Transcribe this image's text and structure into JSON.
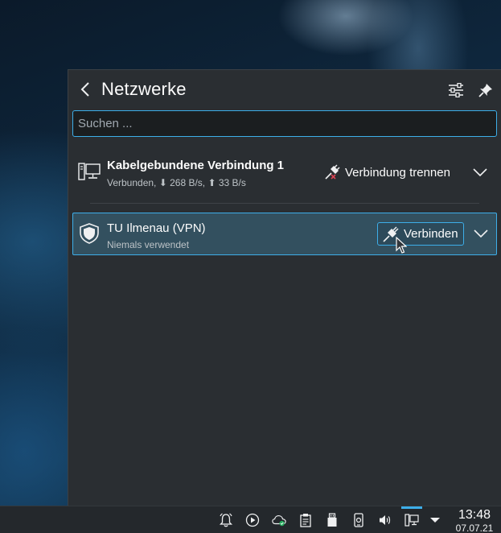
{
  "applet": {
    "title": "Netzwerke",
    "search_placeholder": "Suchen ...",
    "connections": [
      {
        "name": "Kabelgebundene Verbindung 1",
        "status": "Verbunden, ⬇ 268 B/s, ⬆ 33 B/s",
        "action_label": "Verbindung trennen",
        "icon": "wired-network-icon"
      },
      {
        "name": "TU Ilmenau (VPN)",
        "status": "Niemals verwendet",
        "action_label": "Verbinden",
        "icon": "vpn-shield-icon"
      }
    ]
  },
  "taskbar": {
    "tray_icons": [
      "notifications-icon",
      "media-player-icon",
      "cloud-sync-icon",
      "clipboard-icon",
      "usb-device-icon",
      "kdeconnect-phone-icon",
      "volume-icon",
      "network-icon",
      "expand-tray-icon"
    ],
    "time": "13:48",
    "date": "07.07.21"
  },
  "colors": {
    "accent": "#3daee9",
    "panel_bg": "#2a2e32",
    "selected_bg": "#33505f",
    "disconnect_accent": "#da4453"
  }
}
